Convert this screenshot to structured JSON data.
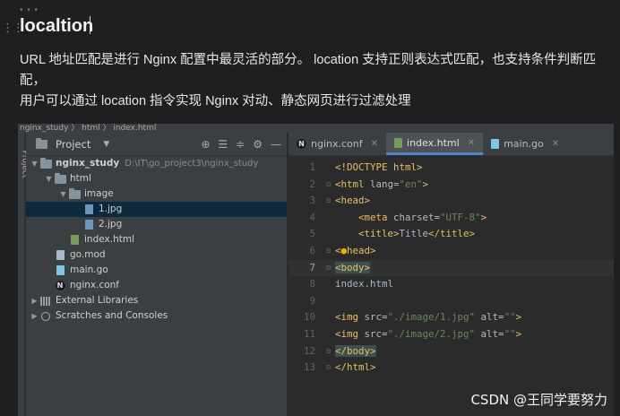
{
  "note": {
    "heading": "localtion",
    "paragraph_line1": "URL 地址匹配是进行 Nginx 配置中最灵活的部分。 location 支持正则表达式匹配，也支持条件判断匹配，",
    "paragraph_line2": "用户可以通过 location 指令实现 Nginx 对动、静态网页进行过滤处理"
  },
  "ide": {
    "breadcrumb": "nginx_study 〉 html 〉 index.html",
    "sidebar_tab": "Project",
    "project_panel": {
      "title": "Project",
      "tree": [
        {
          "label": "nginx_study",
          "path": "D:\\IT\\go_project3\\nginx_study"
        },
        {
          "label": "html"
        },
        {
          "label": "image"
        },
        {
          "label": "1.jpg"
        },
        {
          "label": "2.jpg"
        },
        {
          "label": "index.html"
        },
        {
          "label": "go.mod"
        },
        {
          "label": "main.go"
        },
        {
          "label": "nginx.conf"
        },
        {
          "label": "External Libraries"
        },
        {
          "label": "Scratches and Consoles"
        }
      ]
    },
    "tabs": [
      {
        "label": "nginx.conf"
      },
      {
        "label": "index.html"
      },
      {
        "label": "main.go"
      }
    ],
    "line_numbers": [
      "1",
      "2",
      "3",
      "4",
      "5",
      "6",
      "7",
      "8",
      "9",
      "10",
      "11",
      "12",
      "13"
    ],
    "code": {
      "l1_tag": "<!DOCTYPE html>",
      "l2_open": "<html ",
      "l2_attr": "lang=",
      "l2_val": "\"en\"",
      "l2_close": ">",
      "l3": "<head>",
      "l4_open": "<meta ",
      "l4_attr": "charset=",
      "l4_val": "\"UTF-8\"",
      "l4_close": ">",
      "l5_open": "<title>",
      "l5_text": "Title",
      "l5_close": "</title>",
      "l6_a": "<",
      "l6_b": "head>",
      "l7": "<body>",
      "l8": "index.html",
      "l10_open": "<img ",
      "l10_attr1": "src=",
      "l10_val1": "\"./image/1.jpg\"",
      "l10_attr2": " alt=",
      "l10_val2": "\"\"",
      "l10_close": ">",
      "l11_open": "<img ",
      "l11_attr1": "src=",
      "l11_val1": "\"./image/2.jpg\"",
      "l11_attr2": " alt=",
      "l11_val2": "\"\"",
      "l11_close": ">",
      "l12": "</body>",
      "l13": "</html>"
    }
  },
  "watermark": "CSDN @王同学要努力",
  "icons": {
    "drag_handle": "drag-handle-icon",
    "more": "more-dots-icon",
    "locate": "crosshair-icon",
    "expand": "expand-all-icon",
    "collapse": "collapse-all-icon",
    "settings": "gear-icon",
    "hide": "minus-icon",
    "intention": "lightbulb-icon"
  },
  "colors": {
    "background": "#1f1f21",
    "ide_panel": "#3c3f41",
    "editor": "#2b2b2b",
    "tag": "#e8bf6a",
    "string": "#6a8759",
    "selection": "#0d293e"
  }
}
